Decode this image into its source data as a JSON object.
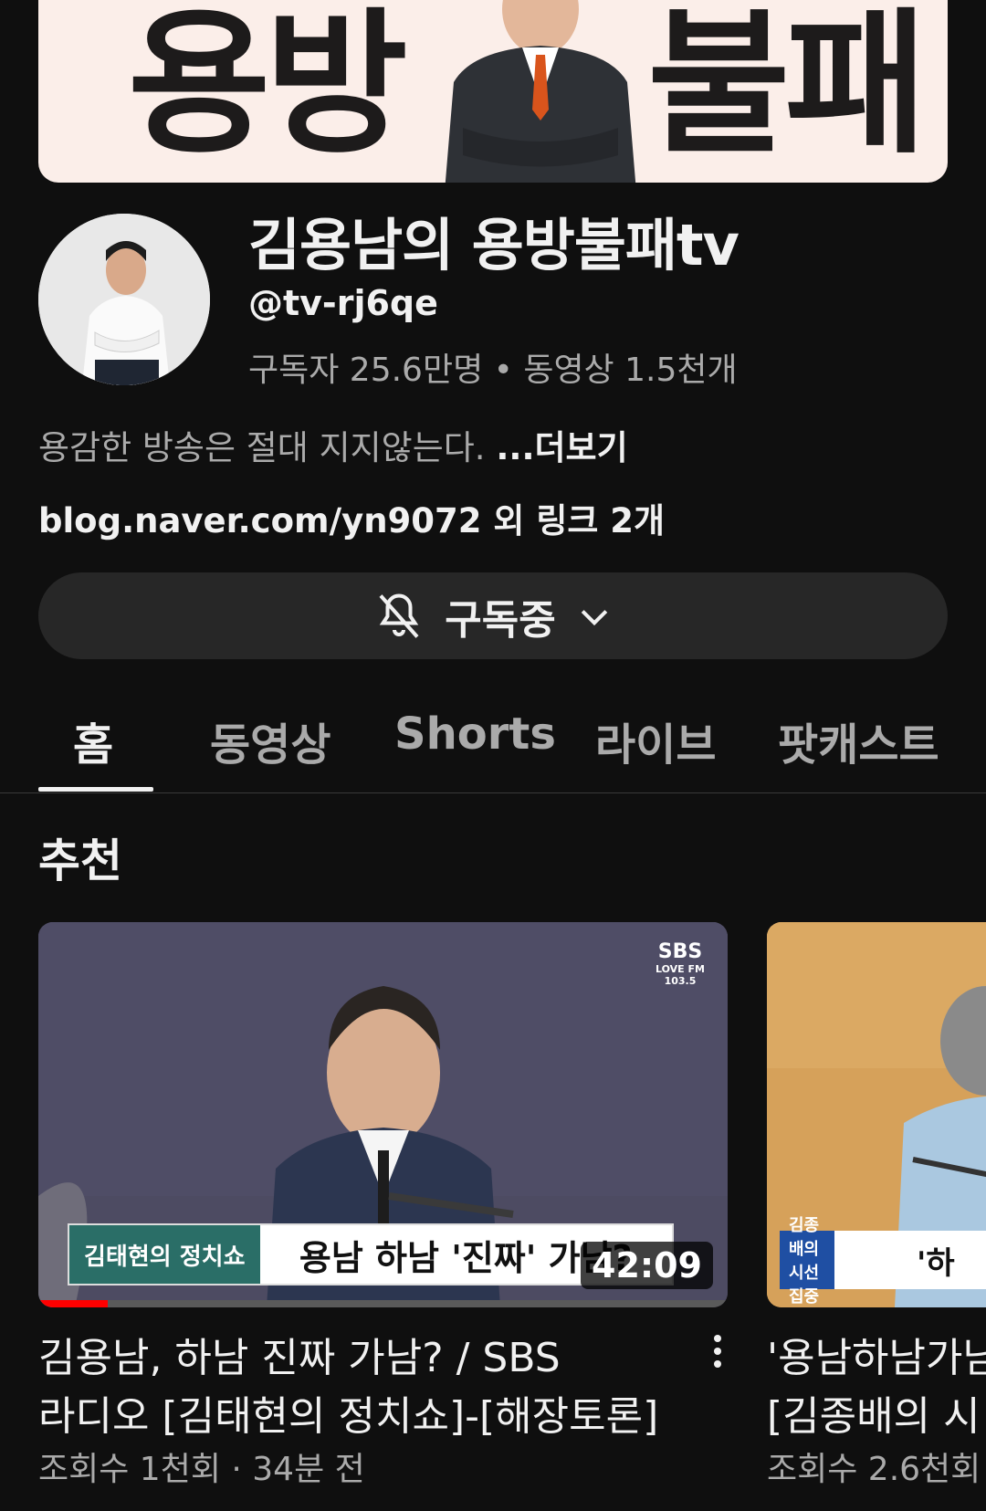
{
  "banner": {
    "left_text": "용방",
    "right_text": "불패"
  },
  "channel": {
    "name": "김용남의 용방불패tv",
    "handle": "@tv-rj6qe",
    "stats": "구독자 25.6만명 • 동영상 1.5천개",
    "description": "용감한 방송은 절대 지지않는다. ",
    "more_label": "...더보기",
    "link": "blog.naver.com/yn9072 외 링크 2개"
  },
  "subscribe": {
    "label": "구독중",
    "bell_icon": "bell-off-icon",
    "dropdown_icon": "chevron-down-icon"
  },
  "tabs": [
    {
      "label": "홈",
      "active": true
    },
    {
      "label": "동영상"
    },
    {
      "label": "Shorts"
    },
    {
      "label": "라이브"
    },
    {
      "label": "팟캐스트"
    }
  ],
  "section": {
    "title": "추천"
  },
  "videos": [
    {
      "thumb_caption_show": "김태현의 정치쇼",
      "thumb_headline": "용남 하남 '진짜' 가남?",
      "thumb_logo": "SBS",
      "thumb_logo_sub": "LOVE FM 103.5",
      "duration": "42:09",
      "watch_progress": 0.1,
      "title_line1": "김용남, 하남 진짜 가남? / SBS",
      "title_line2": "라디오 [김태현의 정치쇼]-[해장토론]",
      "meta": "조회수 1천회 · 34분 전"
    },
    {
      "thumb_caption_show": "김종배의 시선집중",
      "thumb_headline": "'하",
      "title_line1": "'용남하남가남",
      "title_line2": "[김종배의 시",
      "meta": "조회수 2.6천회"
    }
  ]
}
